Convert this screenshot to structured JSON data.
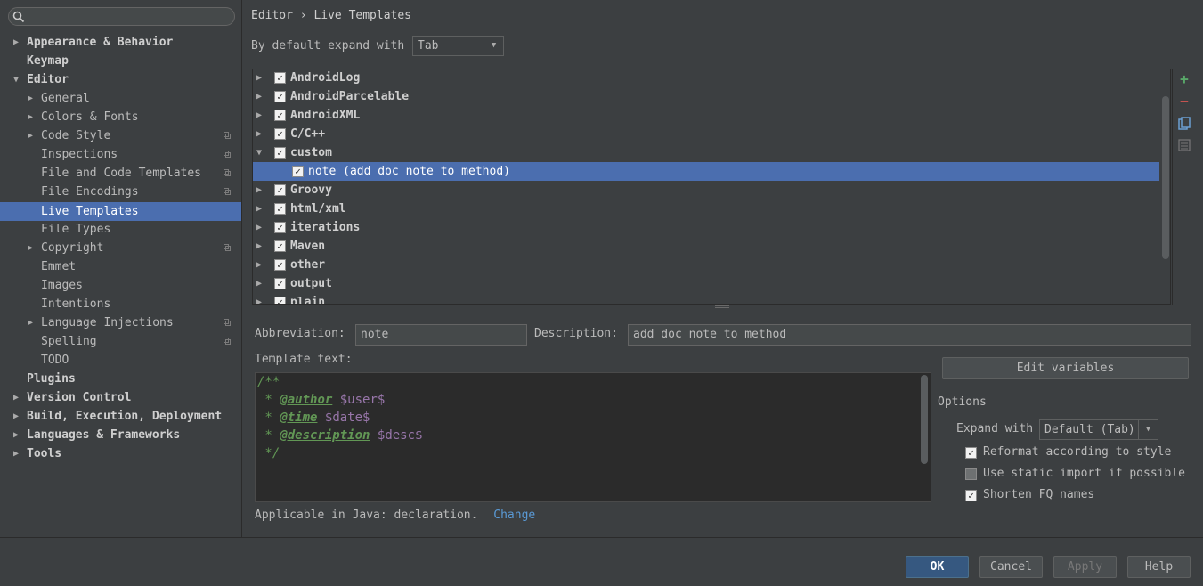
{
  "sidebar": {
    "search": {
      "value": "",
      "placeholder": ""
    },
    "items": [
      {
        "label": "Appearance & Behavior",
        "arrow": "▶"
      },
      {
        "label": "Keymap",
        "arrow": ""
      },
      {
        "label": "Editor",
        "arrow": "▼"
      },
      {
        "label": "General",
        "arrow": "▶"
      },
      {
        "label": "Colors & Fonts",
        "arrow": "▶"
      },
      {
        "label": "Code Style",
        "arrow": "▶"
      },
      {
        "label": "Inspections",
        "arrow": ""
      },
      {
        "label": "File and Code Templates",
        "arrow": ""
      },
      {
        "label": "File Encodings",
        "arrow": ""
      },
      {
        "label": "Live Templates",
        "arrow": ""
      },
      {
        "label": "File Types",
        "arrow": ""
      },
      {
        "label": "Copyright",
        "arrow": "▶"
      },
      {
        "label": "Emmet",
        "arrow": ""
      },
      {
        "label": "Images",
        "arrow": ""
      },
      {
        "label": "Intentions",
        "arrow": ""
      },
      {
        "label": "Language Injections",
        "arrow": "▶"
      },
      {
        "label": "Spelling",
        "arrow": ""
      },
      {
        "label": "TODO",
        "arrow": ""
      },
      {
        "label": "Plugins",
        "arrow": ""
      },
      {
        "label": "Version Control",
        "arrow": "▶"
      },
      {
        "label": "Build, Execution, Deployment",
        "arrow": "▶"
      },
      {
        "label": "Languages & Frameworks",
        "arrow": "▶"
      },
      {
        "label": "Tools",
        "arrow": "▶"
      }
    ],
    "selected": "Live Templates"
  },
  "header": {
    "breadcrumb": "Editor › Live Templates",
    "expand_label": "By default expand with",
    "expand_value": "Tab"
  },
  "tree": {
    "rows": [
      {
        "label": "AndroidLog",
        "arrow": "▶"
      },
      {
        "label": "AndroidParcelable",
        "arrow": "▶"
      },
      {
        "label": "AndroidXML",
        "arrow": "▶"
      },
      {
        "label": "C/C++",
        "arrow": "▶"
      },
      {
        "label": "custom",
        "arrow": "▼"
      },
      {
        "label": "note (add doc note to method)",
        "arrow": ""
      },
      {
        "label": "Groovy",
        "arrow": "▶"
      },
      {
        "label": "html/xml",
        "arrow": "▶"
      },
      {
        "label": "iterations",
        "arrow": "▶"
      },
      {
        "label": "Maven",
        "arrow": "▶"
      },
      {
        "label": "other",
        "arrow": "▶"
      },
      {
        "label": "output",
        "arrow": "▶"
      },
      {
        "label": "plain",
        "arrow": "▶"
      }
    ],
    "check_mark": "✓",
    "toolbar": {
      "add": "+",
      "remove": "−"
    }
  },
  "editor": {
    "abbreviation_label": "Abbreviation:",
    "abbreviation_value": "note",
    "description_label": "Description:",
    "description_value": "add doc note to method",
    "template_text_label": "Template text:",
    "code": {
      "line1": "/**",
      "star": " * ",
      "tag_author": "@author",
      "var_user": "$user$",
      "tag_time": "@time",
      "var_date": "$date$",
      "tag_description": "@description",
      "var_desc": "$desc$",
      "close": " */"
    },
    "edit_variables": "Edit variables",
    "applicable_text": "Applicable in Java: declaration.",
    "change_link": "Change"
  },
  "options": {
    "title": "Options",
    "expand_with_label": "Expand with",
    "expand_with_value": "Default (Tab)",
    "checkboxes": [
      {
        "label": "Reformat according to style",
        "checked": true
      },
      {
        "label": "Use static import if possible",
        "checked": false
      },
      {
        "label": "Shorten FQ names",
        "checked": true
      }
    ]
  },
  "footer": {
    "ok": "OK",
    "cancel": "Cancel",
    "apply": "Apply",
    "help": "Help"
  },
  "colors": {
    "background": "#3c3f41",
    "selection": "#4b6eaf",
    "editor_bg": "#2b2b2b",
    "javadoc": "#629755",
    "template_var": "#9876aa",
    "link": "#5a9ad6",
    "add_icon": "#59a869",
    "remove_icon": "#c75450"
  }
}
